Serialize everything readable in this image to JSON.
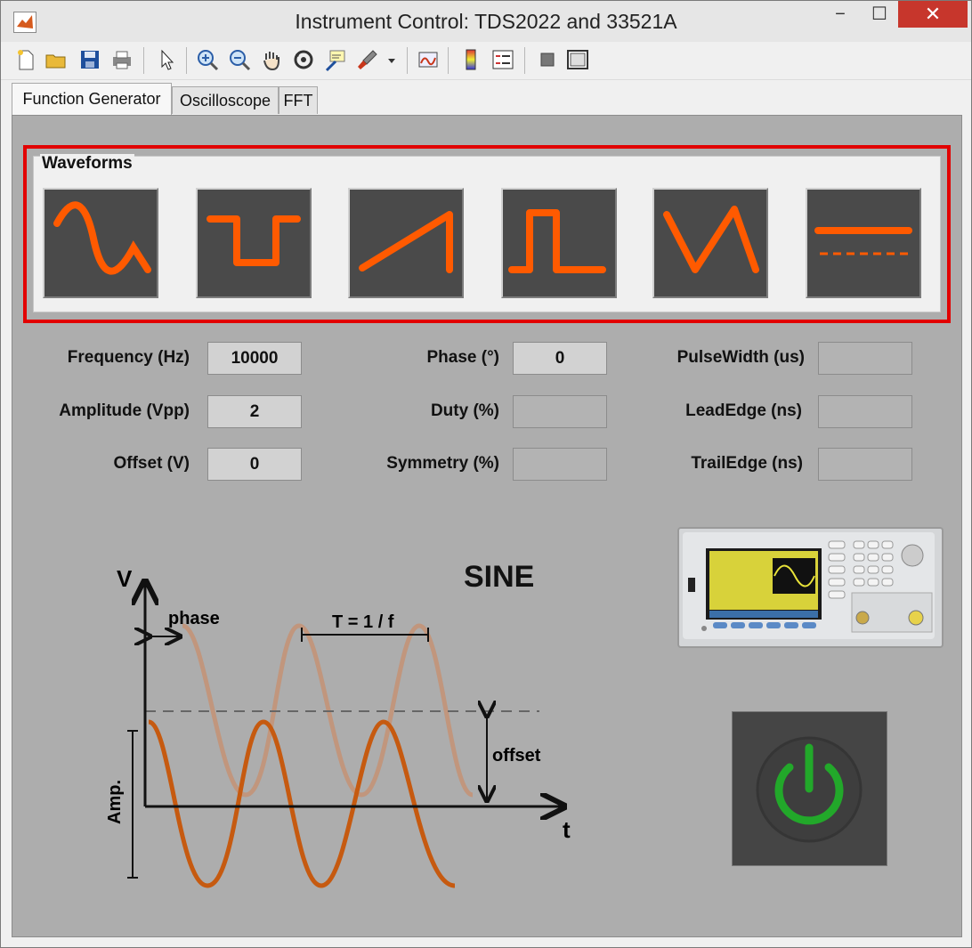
{
  "window": {
    "title": "Instrument Control: TDS2022 and 33521A",
    "minimize_label": "−",
    "maximize_label": "☐",
    "close_label": "✕"
  },
  "tabs": [
    {
      "label": "Function Generator",
      "active": true
    },
    {
      "label": "Oscilloscope",
      "active": false
    },
    {
      "label": "FFT",
      "active": false
    }
  ],
  "waveforms": {
    "title": "Waveforms",
    "buttons": [
      "sine",
      "square",
      "ramp",
      "pulse",
      "triangle",
      "dc"
    ],
    "accent_color": "#ff5a00"
  },
  "params": {
    "frequency": {
      "label": "Frequency (Hz)",
      "value": "10000"
    },
    "amplitude": {
      "label": "Amplitude (Vpp)",
      "value": "2"
    },
    "offset": {
      "label": "Offset (V)",
      "value": "0"
    },
    "phase": {
      "label": "Phase (°)",
      "value": "0"
    },
    "duty": {
      "label": "Duty (%)",
      "value": ""
    },
    "symmetry": {
      "label": "Symmetry (%)",
      "value": ""
    },
    "pulsewidth": {
      "label": "PulseWidth (us)",
      "value": ""
    },
    "leadedge": {
      "label": "LeadEdge (ns)",
      "value": ""
    },
    "trailedge": {
      "label": "TrailEdge (ns)",
      "value": ""
    }
  },
  "diagram": {
    "waveform_name": "SINE",
    "axis_v": "V",
    "axis_t": "t",
    "phase_label": "phase",
    "period_label": "T = 1 / f",
    "offset_label": "offset",
    "amp_label": "Amp."
  },
  "power_button": {
    "color": "#22a82a"
  }
}
